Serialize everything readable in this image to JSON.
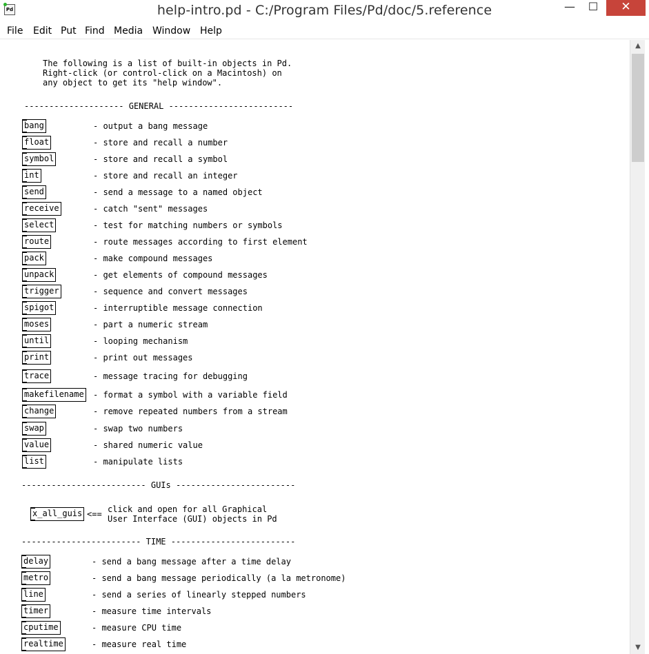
{
  "window": {
    "title": "help-intro.pd  - C:/Program Files/Pd/doc/5.reference",
    "app_icon_label": "Pd",
    "minimize_glyph": "—",
    "maximize_glyph": "☐",
    "close_glyph": "✕"
  },
  "menu": [
    "File",
    "Edit",
    "Put",
    "Find",
    "Media",
    "Window",
    "Help"
  ],
  "intro": [
    "The following is a list of built-in objects in Pd.",
    "Right-click (or control-click on a Macintosh) on",
    "any object to get its \"help window\"."
  ],
  "headers": {
    "general": "-------------------- GENERAL -------------------------",
    "guis": "------------------------- GUIs ------------------------",
    "time": "------------------------ TIME -------------------------"
  },
  "general": [
    {
      "name": "bang",
      "desc": "- output a bang message"
    },
    {
      "name": "float",
      "desc": "- store and recall a number"
    },
    {
      "name": "symbol",
      "desc": "- store and recall a symbol"
    },
    {
      "name": "int",
      "desc": "- store and recall an integer"
    },
    {
      "name": "send",
      "desc": "- send a message to a named object"
    },
    {
      "name": "receive",
      "desc": "- catch \"sent\" messages"
    },
    {
      "name": "select",
      "desc": "- test for matching numbers or symbols"
    },
    {
      "name": "route",
      "desc": "- route messages according to first element"
    },
    {
      "name": "pack",
      "desc": "- make compound messages"
    },
    {
      "name": "unpack",
      "desc": "- get elements of compound messages"
    },
    {
      "name": "trigger",
      "desc": "- sequence and convert messages"
    },
    {
      "name": "spigot",
      "desc": "- interruptible message connection"
    },
    {
      "name": "moses",
      "desc": "- part a numeric stream"
    },
    {
      "name": "until",
      "desc": "- looping mechanism"
    },
    {
      "name": "print",
      "desc": "- print out messages"
    },
    {
      "name": "trace",
      "desc": "- message tracing for debugging"
    },
    {
      "name": "makefilename",
      "desc": "- format a symbol with a variable field"
    },
    {
      "name": "change",
      "desc": "- remove repeated numbers from a stream"
    },
    {
      "name": "swap",
      "desc": "- swap two numbers"
    },
    {
      "name": "value",
      "desc": "- shared numeric value"
    },
    {
      "name": "list",
      "desc": "- manipulate lists"
    }
  ],
  "guis": {
    "object": "x_all_guis",
    "arrow": "<==",
    "desc_lines": [
      "click and open for all Graphical",
      "User Interface (GUI) objects in Pd"
    ]
  },
  "time": [
    {
      "name": "delay",
      "desc": "- send a bang message after a time delay"
    },
    {
      "name": "metro",
      "desc": "- send a bang message periodically (a la metronome)"
    },
    {
      "name": "line",
      "desc": "- send a series of linearly stepped numbers"
    },
    {
      "name": "timer",
      "desc": "- measure time intervals"
    },
    {
      "name": "cputime",
      "desc": "- measure CPU time"
    },
    {
      "name": "realtime",
      "desc": "- measure real time"
    }
  ],
  "scrollbar": {
    "up_glyph": "▲",
    "down_glyph": "▼"
  }
}
